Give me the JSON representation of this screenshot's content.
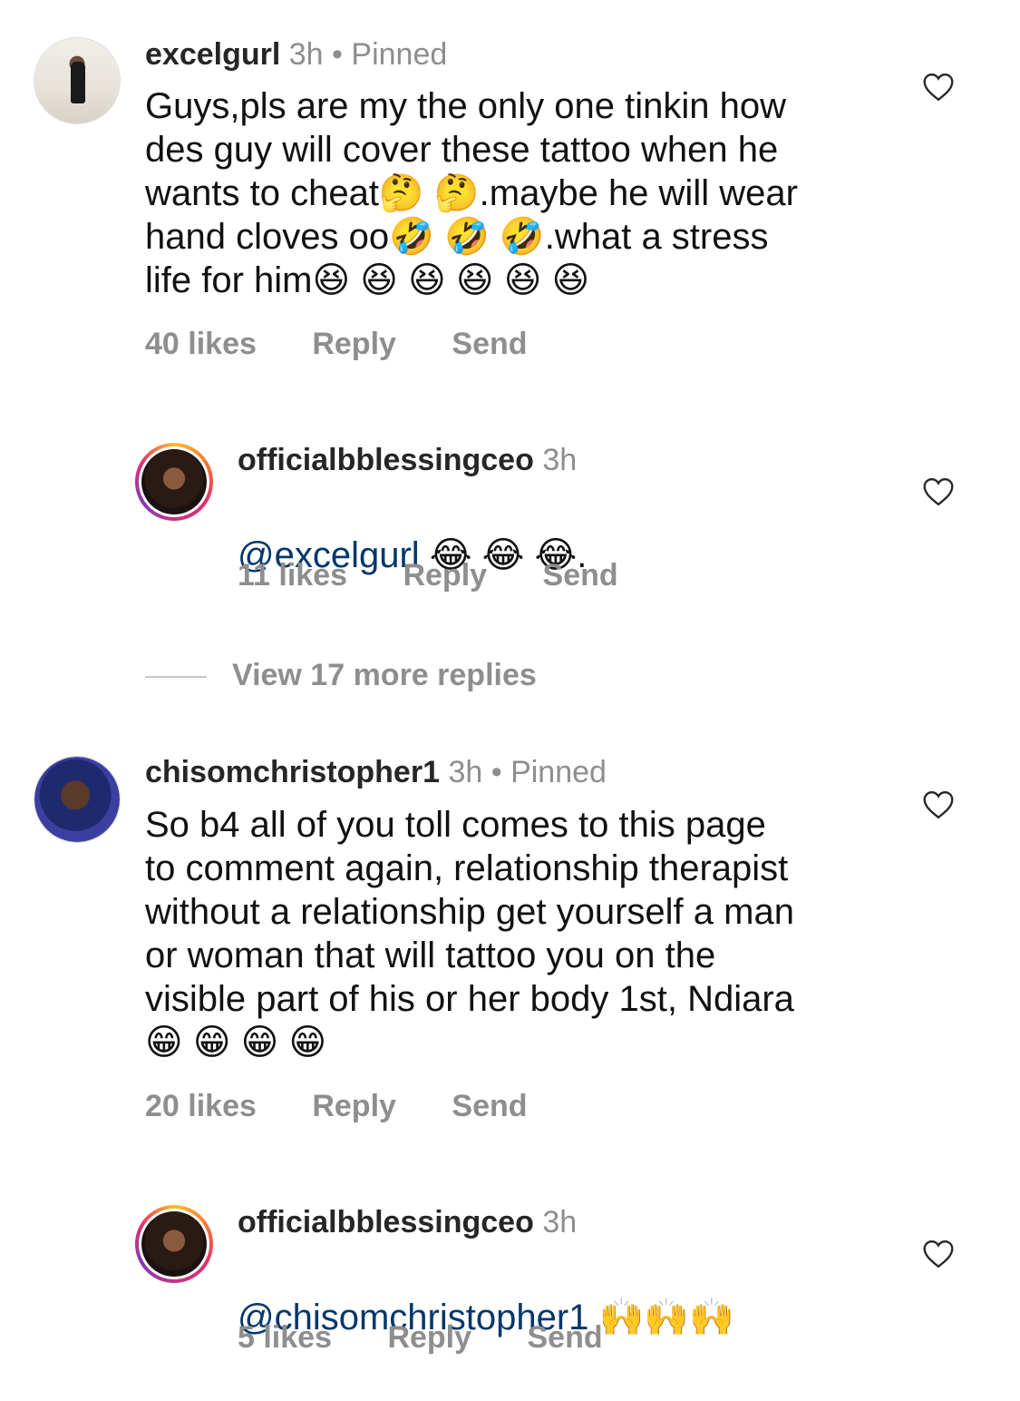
{
  "comments": [
    {
      "username": "excelgurl",
      "time": "3h",
      "pinned": "Pinned",
      "text": "Guys,pls are my the only one tinkin how\ndes guy will cover these tattoo when he\nwants to cheat🤔 🤔.maybe he will wear\nhand cloves oo🤣 🤣 🤣.what a stress\nlife for him😆 😆 😆 😆 😆 😆",
      "likes": "40 likes",
      "reply": "Reply",
      "send": "Send"
    },
    {
      "username": "officialbblessingceo",
      "time": "3h",
      "mention": "@excelgurl",
      "text": " 😂 😂 😂.",
      "likes": "11 likes",
      "reply": "Reply",
      "send": "Send"
    },
    {
      "username": "chisomchristopher1",
      "time": "3h",
      "pinned": "Pinned",
      "text": "So b4 all of you toll comes to this page\nto comment again, relationship therapist\nwithout a relationship get yourself a man\nor woman that will tattoo you on the\nvisible part of his or her body 1st, Ndiara\n😁 😁 😁 😁",
      "likes": "20 likes",
      "reply": "Reply",
      "send": "Send"
    },
    {
      "username": "officialbblessingceo",
      "time": "3h",
      "mention": "@chisomchristopher1",
      "text": " 🙌🙌🙌",
      "likes": "5 likes",
      "reply": "Reply",
      "send": "Send"
    }
  ],
  "view_more": "View 17 more replies",
  "separator": "•",
  "icons": {
    "like": "heart-outline-icon"
  }
}
